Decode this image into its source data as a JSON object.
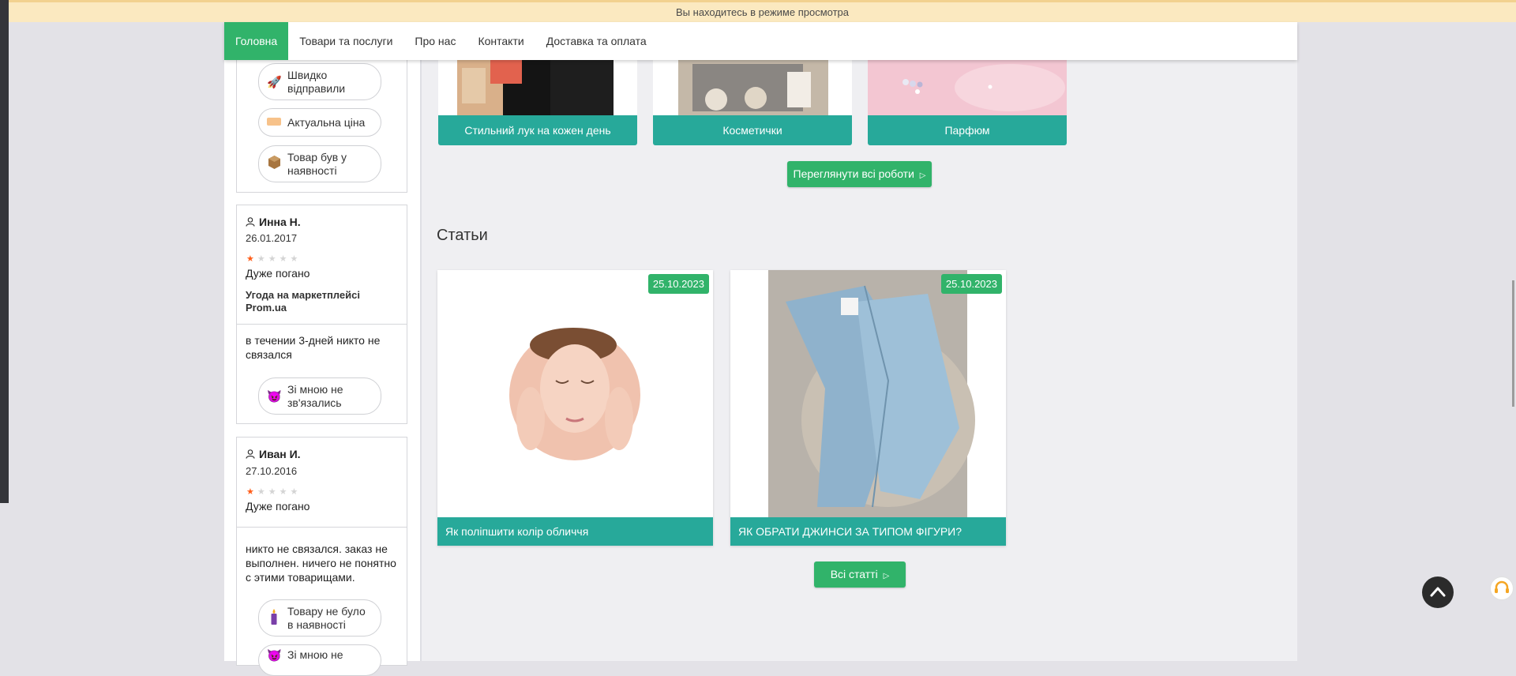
{
  "banner": {
    "text": "Вы находитесь в режиме просмотра"
  },
  "nav": {
    "items": [
      {
        "label": "Головна"
      },
      {
        "label": "Товари та послуги"
      },
      {
        "label": "Про нас"
      },
      {
        "label": "Контакти"
      },
      {
        "label": "Доставка та оплата"
      }
    ]
  },
  "sidebar": {
    "top_tags": [
      {
        "label": "Швидко відправили",
        "icon": "rocket-icon"
      },
      {
        "label": "Актуальна ціна",
        "icon": "price-tag-icon"
      },
      {
        "label": "Товар був у наявності",
        "icon": "box-icon"
      }
    ],
    "reviews": [
      {
        "name": "Инна Н.",
        "date": "26.01.2017",
        "rating": 1,
        "verdict": "Дуже погано",
        "deal": "Угода на маркетплейсі Prom.ua",
        "comment": "в течении 3-дней никто не связался",
        "tags": [
          {
            "label": "Зі мною не зв'язались",
            "icon": "devil-icon"
          }
        ]
      },
      {
        "name": "Иван И.",
        "date": "27.10.2016",
        "rating": 1,
        "verdict": "Дуже погано",
        "comment": "никто не связался. заказ не выполнен. ничего не понятно с этими товарищами.",
        "tags": [
          {
            "label": "Товару не було в наявності",
            "icon": "candle-icon"
          },
          {
            "label": "Зі мною не",
            "icon": "devil-icon"
          }
        ]
      }
    ]
  },
  "works": {
    "items": [
      {
        "caption": "Стильний лук на кожен день"
      },
      {
        "caption": "Косметички"
      },
      {
        "caption": "Парфюм"
      }
    ],
    "view_all": "Переглянути всі роботи"
  },
  "articles": {
    "heading": "Статьи",
    "items": [
      {
        "date": "25.10.2023",
        "title": "Як поліпшити колір обличчя"
      },
      {
        "date": "25.10.2023",
        "title": "ЯК ОБРАТИ ДЖИНСИ ЗА ТИПОМ ФІГУРИ?"
      }
    ],
    "all_label": "Всі статті"
  },
  "colors": {
    "nav_active": "#31b36a",
    "caption_bg": "#27a99a",
    "banner_bg": "#fbe9c0",
    "star_on": "#ff5e1a"
  }
}
